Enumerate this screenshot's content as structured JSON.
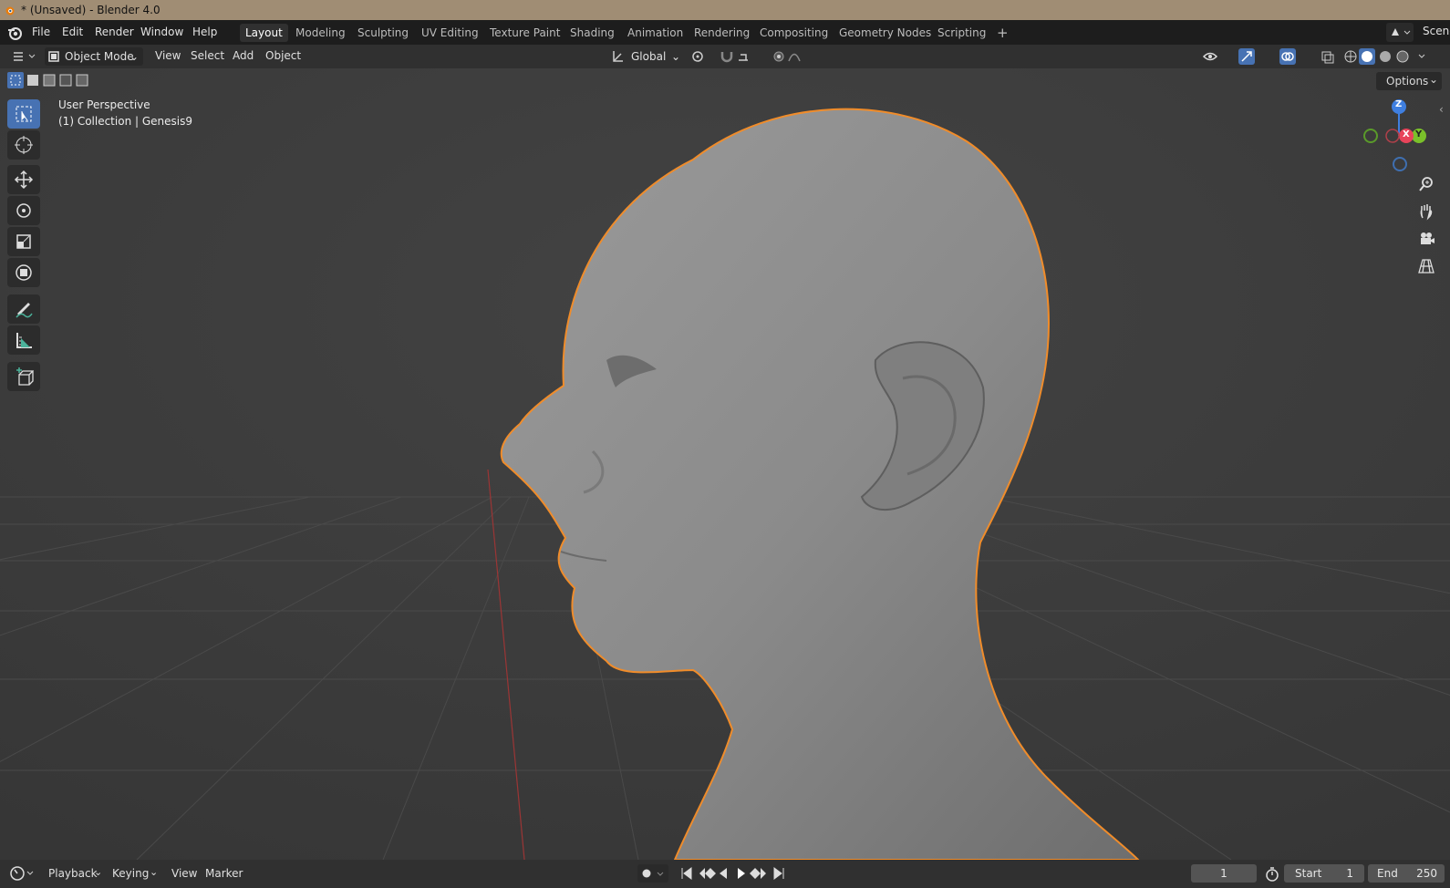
{
  "window": {
    "title": "* (Unsaved) - Blender 4.0"
  },
  "menu": [
    "File",
    "Edit",
    "Render",
    "Window",
    "Help"
  ],
  "workspaces": [
    "Layout",
    "Modeling",
    "Sculpting",
    "UV Editing",
    "Texture Paint",
    "Shading",
    "Animation",
    "Rendering",
    "Compositing",
    "Geometry Nodes",
    "Scripting"
  ],
  "active_workspace": "Layout",
  "add_workspace": "+",
  "scene_label": "Scene",
  "header": {
    "mode": "Object Mode",
    "menus": [
      "View",
      "Select",
      "Add",
      "Object"
    ],
    "transform_orientation": "Global"
  },
  "viewport": {
    "options": "Options",
    "perspective": "User Perspective",
    "collection": "(1) Collection | Genesis9",
    "gizmo_axes": {
      "z": "Z",
      "x": "X",
      "y": "Y"
    }
  },
  "timeline": {
    "menus": [
      "Playback",
      "Keying",
      "View",
      "Marker"
    ],
    "current_frame": "1",
    "start_label": "Start",
    "start_value": "1",
    "end_label": "End",
    "end_value": "250"
  },
  "colors": {
    "selection_outline": "#f08c2a",
    "active_tool": "#4772b3",
    "axis_x": "#e8445a",
    "axis_y": "#7ac02a",
    "axis_z": "#3f7fe0"
  }
}
